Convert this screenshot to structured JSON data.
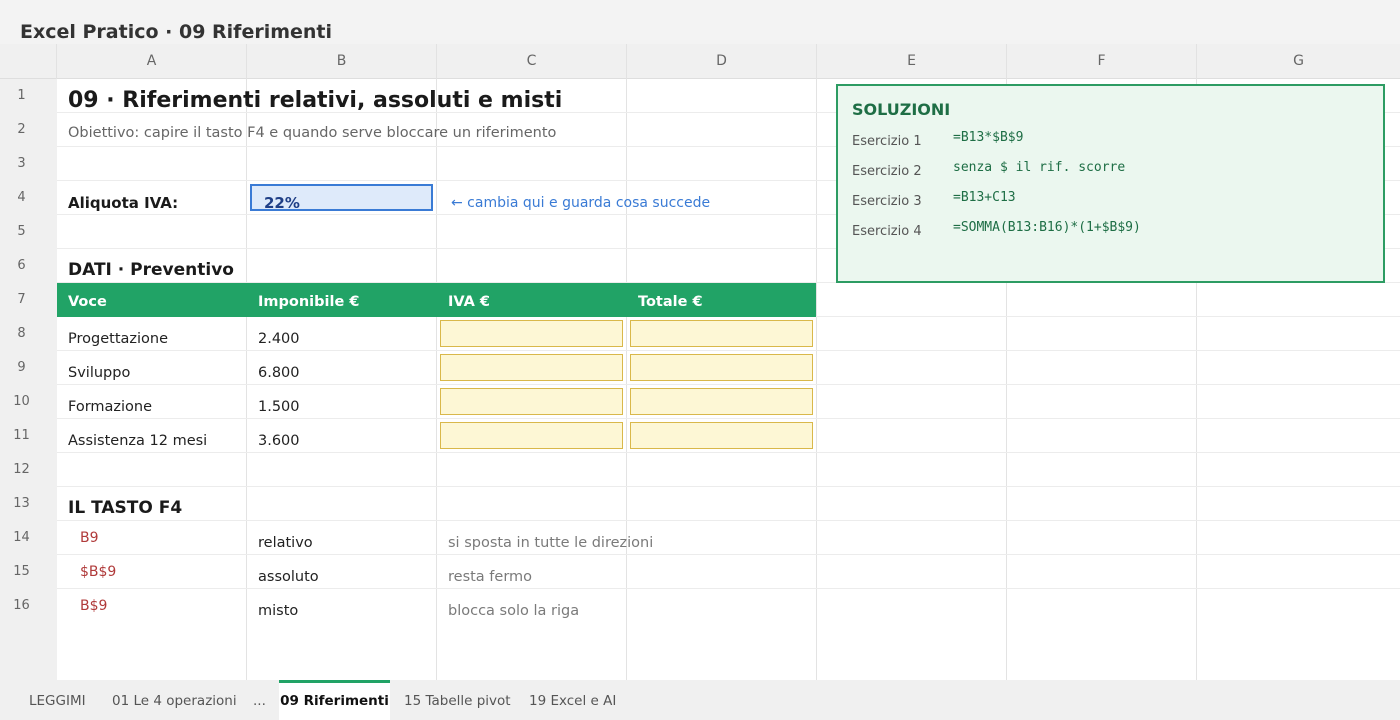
{
  "window": {
    "title": "Excel Pratico  ·  09 Riferimenti"
  },
  "columns": [
    "A",
    "B",
    "C",
    "D",
    "E",
    "F",
    "G"
  ],
  "rows": [
    "1",
    "2",
    "3",
    "4",
    "5",
    "6",
    "7",
    "8",
    "9",
    "10",
    "11",
    "12",
    "13",
    "14",
    "15",
    "16"
  ],
  "sheet": {
    "title": "09 · Riferimenti relativi, assoluti e misti",
    "objective": "Obiettivo: capire il tasto F4 e quando serve bloccare un riferimento",
    "vat_label": "Aliquota IVA:",
    "vat_value": "22%",
    "vat_hint": "← cambia qui e guarda cosa succede",
    "data_section": "DATI · Preventivo",
    "table": {
      "headers": [
        "Voce",
        "Imponibile €",
        "IVA €",
        "Totale €"
      ],
      "rows": [
        {
          "voce": "Progettazione",
          "imponibile": "2.400"
        },
        {
          "voce": "Sviluppo",
          "imponibile": "6.800"
        },
        {
          "voce": "Formazione",
          "imponibile": "1.500"
        },
        {
          "voce": "Assistenza 12 mesi",
          "imponibile": "3.600"
        }
      ]
    },
    "f4_section": "IL TASTO F4",
    "f4_rows": [
      {
        "ref": "B9",
        "type": "relativo",
        "desc": "si sposta in tutte le direzioni"
      },
      {
        "ref": "$B$9",
        "type": "assoluto",
        "desc": "resta fermo"
      },
      {
        "ref": "B$9",
        "type": "misto",
        "desc": "blocca solo la riga"
      }
    ]
  },
  "solutions": {
    "title": "SOLUZIONI",
    "items": [
      {
        "label": "Esercizio 1",
        "value": "=B13*$B$9"
      },
      {
        "label": "Esercizio 2",
        "value": "senza $ il rif. scorre"
      },
      {
        "label": "Esercizio 3",
        "value": "=B13+C13"
      },
      {
        "label": "Esercizio 4",
        "value": "=SOMMA(B13:B16)*(1+$B$9)"
      }
    ]
  },
  "tabs": [
    "LEGGIMI",
    "01 Le 4 operazioni",
    "...",
    "09 Riferimenti",
    "15 Tabelle pivot",
    "19 Excel e AI"
  ],
  "active_tab_index": 3,
  "colors": {
    "accent_green": "#21a366",
    "input_blue": "#3a7bd5",
    "input_fill": "#fdf7d5",
    "solution_green": "#1e6e45"
  }
}
